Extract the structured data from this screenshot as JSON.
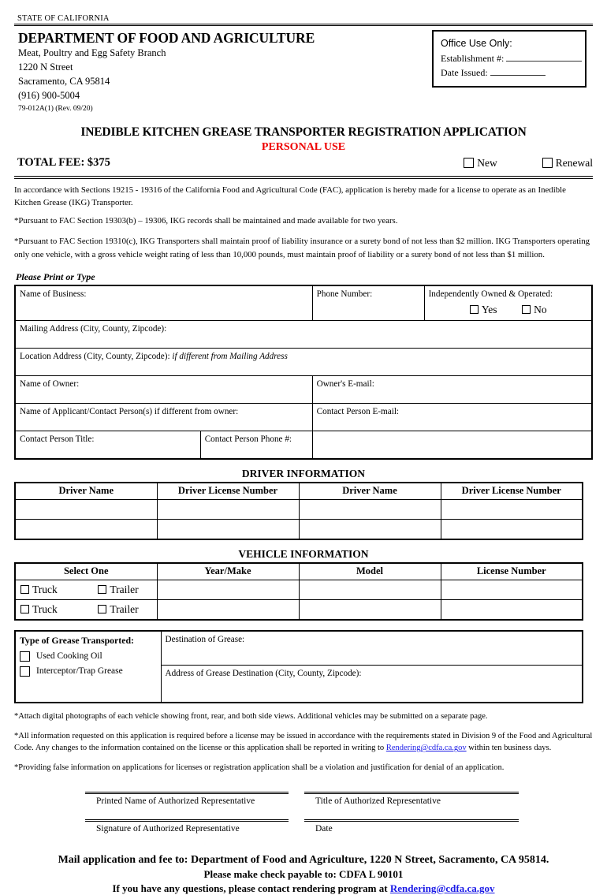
{
  "header": {
    "state_line": "STATE OF CALIFORNIA",
    "department": "DEPARTMENT OF FOOD AND AGRICULTURE",
    "branch": "Meat, Poultry and Egg Safety Branch",
    "street": "1220 N Street",
    "city_state_zip": "Sacramento, CA  95814",
    "phone": "(916) 900-5004",
    "form_number": "79-012A(1)  (Rev. 09/20)"
  },
  "office_use": {
    "title": "Office Use Only:",
    "establishment_label": "Establishment #:",
    "date_issued_label": "Date Issued:"
  },
  "title": {
    "main": "INEDIBLE KITCHEN GREASE TRANSPORTER REGISTRATION APPLICATION",
    "sub": "PERSONAL USE",
    "sub_color": "#ee0000",
    "total_fee": "TOTAL FEE: $375",
    "new_label": "New",
    "renewal_label": "Renewal"
  },
  "intro": {
    "p1": "In accordance with Sections 19215 - 19316 of the California Food and Agricultural Code (FAC), application is hereby made for a license to operate as an Inedible Kitchen Grease (IKG) Transporter.",
    "p2": "*Pursuant to FAC Section 19303(b) – 19306, IKG records shall be maintained and made available for two years.",
    "p3": "*Pursuant to FAC Section 19310(c), IKG Transporters shall maintain proof of liability insurance or a surety bond of not less than $2 million. IKG Transporters operating only one vehicle, with a gross vehicle weight rating of less than 10,000 pounds, must maintain proof of liability or a surety bond of not less than $1 million.",
    "print_or_type": "Please Print or Type"
  },
  "applicant": {
    "name_of_business": "Name of Business:",
    "phone_number": "Phone Number:",
    "independently_owned": "Independently Owned & Operated:",
    "yes": "Yes",
    "no": "No",
    "mailing_address": "Mailing Address (City, County, Zipcode):",
    "location_address": "Location Address (City, County, Zipcode):",
    "location_address_italic": "if different from Mailing Address",
    "name_of_owner": "Name of Owner:",
    "owner_email": "Owner's E-mail:",
    "name_of_applicant": "Name of Applicant/Contact Person(s) if different from owner:",
    "contact_person_email": "Contact Person E-mail:",
    "contact_person_title": "Contact Person Title:",
    "contact_person_phone": "Contact Person Phone #:"
  },
  "driver_information": {
    "heading": "DRIVER INFORMATION",
    "columns": [
      "Driver Name",
      "Driver License Number",
      "Driver Name",
      "Driver License Number"
    ],
    "rows": [
      [
        "",
        "",
        "",
        ""
      ],
      [
        "",
        "",
        "",
        ""
      ]
    ]
  },
  "vehicle_information": {
    "heading": "VEHICLE INFORMATION",
    "columns": [
      "Select One",
      "Year/Make",
      "Model",
      "License Number"
    ],
    "truck_label": "Truck",
    "trailer_label": "Trailer",
    "rows": [
      [
        "",
        "",
        ""
      ],
      [
        "",
        "",
        ""
      ]
    ]
  },
  "grease": {
    "type_label": "Type of Grease Transported:",
    "option_used_cooking_oil": "Used Cooking Oil",
    "option_interceptor": "Interceptor/Trap Grease",
    "destination_label": "Destination of Grease:",
    "destination_address_label": "Address of Grease Destination (City, County, Zipcode):"
  },
  "footnotes": {
    "f1": "*Attach digital photographs of each vehicle showing front, rear, and both side views. Additional vehicles may be submitted on a separate page.",
    "f2_a": "*All information requested on this application is required before a license may be issued in accordance with the requirements stated in Division 9 of the Food and Agricultural Code. Any changes to the information contained on the license or this application shall be reported in writing to ",
    "f2_link": "Rendering@cdfa.ca.gov",
    "f2_b": " within ten business days.",
    "f3": "*Providing false information on applications for licenses or registration application shall be a violation and justification for denial of an application."
  },
  "signature": {
    "printed_name": "Printed Name of Authorized Representative",
    "title": "Title of Authorized Representative",
    "signature": "Signature of Authorized Representative",
    "date": "Date"
  },
  "footer": {
    "line1": "Mail application and fee to: Department of Food and Agriculture, 1220 N Street, Sacramento, CA 95814.",
    "line2": "Please make check payable to: CDFA L 90101",
    "line3_a": "If you have any questions, please contact rendering program at ",
    "line3_link": "Rendering@cdfa.ca.gov"
  }
}
